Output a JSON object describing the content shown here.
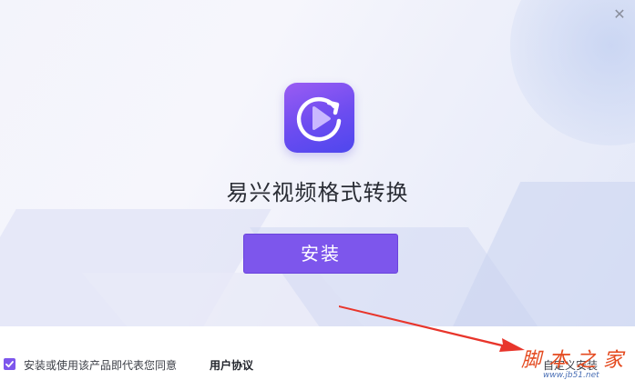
{
  "window": {
    "close_glyph": "✕"
  },
  "app": {
    "icon": "replay-play-icon",
    "title": "易兴视频格式转换"
  },
  "install_button": {
    "label": "安装"
  },
  "footer": {
    "agreement_checked": true,
    "agreement_text": "安装或使用该产品即代表您同意",
    "agreement_link": "用户协议",
    "custom_install": "自定义安装"
  },
  "watermark": {
    "main": "脚本之家",
    "sub": "www.jb51.net"
  },
  "colors": {
    "accent": "#7d56ec",
    "arrow": "#e8352b"
  }
}
